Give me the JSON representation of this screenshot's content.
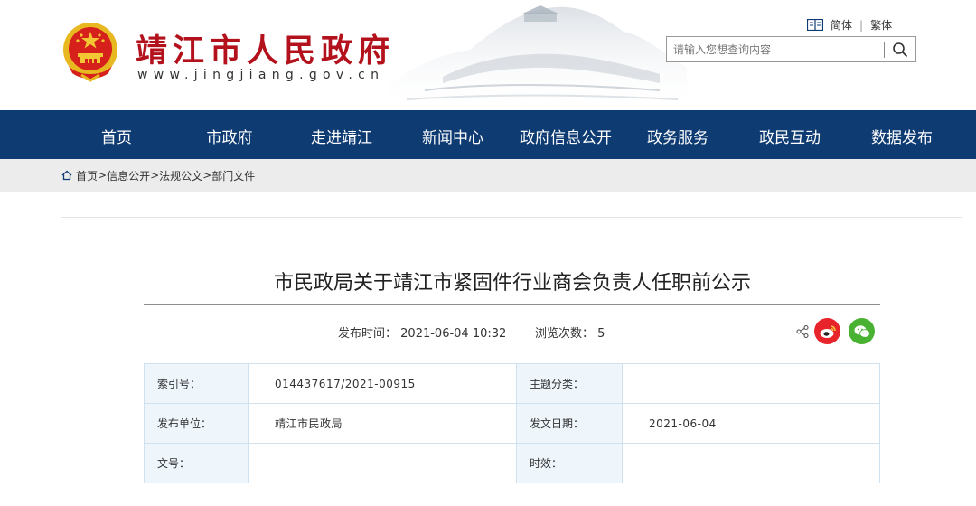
{
  "header": {
    "site_title": "靖江市人民政府",
    "site_url": "www.jingjiang.gov.cn",
    "lang_simplified": "简体",
    "lang_sep": "|",
    "lang_traditional": "繁体",
    "search_placeholder": "请输入您想查询内容",
    "colors": {
      "brand_red": "#b3111c",
      "nav_blue": "#0f3b73"
    }
  },
  "nav": {
    "items": [
      "首页",
      "市政府",
      "走进靖江",
      "新闻中心",
      "政府信息公开",
      "政务服务",
      "政民互动",
      "数据发布"
    ]
  },
  "breadcrumb": {
    "home": "首页",
    "sep": ">",
    "items": [
      "信息公开",
      "法规公文",
      "部门文件"
    ]
  },
  "article": {
    "title": "市民政局关于靖江市紧固件行业商会负责人任职前公示",
    "publish_label": "发布时间：",
    "publish_time": "2021-06-04 10:32",
    "views_label": "浏览次数：",
    "views": "5",
    "share_icons": [
      "share-icon",
      "weibo-icon",
      "wechat-icon"
    ]
  },
  "info_table": {
    "rows": [
      {
        "l1": "索引号：",
        "v1": "014437617/2021-00915",
        "l2": "主题分类：",
        "v2": ""
      },
      {
        "l1": "发布单位：",
        "v1": "靖江市民政局",
        "l2": "发文日期：",
        "v2": "2021-06-04"
      },
      {
        "l1": "文号：",
        "v1": "",
        "l2": "时效：",
        "v2": ""
      }
    ]
  }
}
